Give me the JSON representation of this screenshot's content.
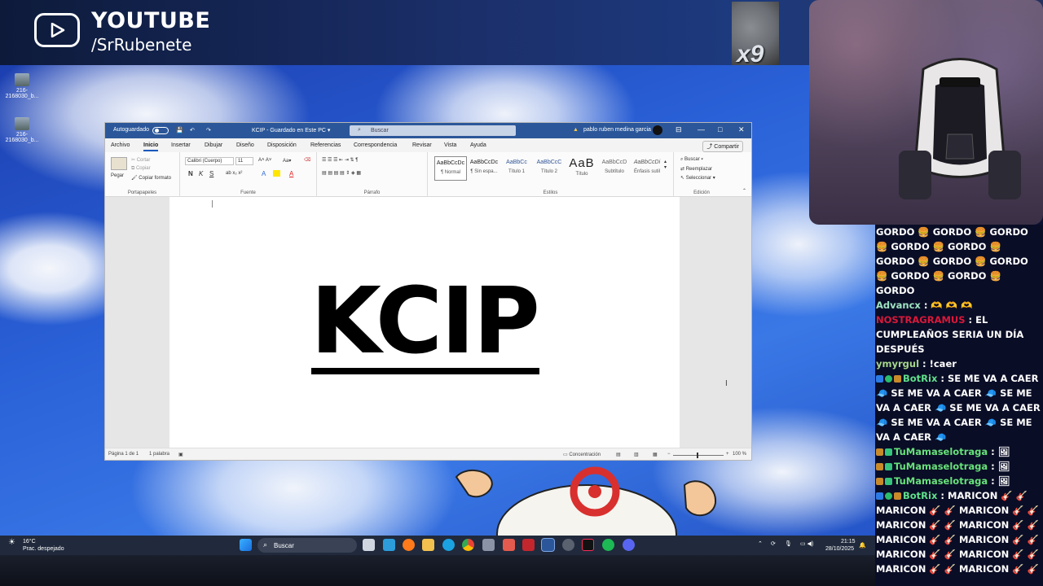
{
  "overlay": {
    "platform": "YOUTUBE",
    "handle": "/SrRubenete",
    "multiplier": "x9"
  },
  "desktop": {
    "icons": [
      {
        "label": "216-2168030_b..."
      },
      {
        "label": "216-2168030_b..."
      }
    ]
  },
  "word": {
    "autosave_label": "Autoguardado",
    "doc_title": "KCIP  -  Guardado en Este PC  ▾",
    "search_placeholder": "Buscar",
    "user_name": "pablo ruben medina garcia",
    "menu_tabs": [
      "Archivo",
      "Inicio",
      "Insertar",
      "Dibujar",
      "Diseño",
      "Disposición",
      "Referencias",
      "Correspondencia",
      "Revisar",
      "Vista",
      "Ayuda"
    ],
    "active_tab": "Inicio",
    "share_label": "Compartir",
    "clipboard": {
      "paste": "Pegar",
      "cut": "Cortar",
      "copy": "Copiar",
      "format_painter": "Copiar formato",
      "group": "Portapapeles"
    },
    "font": {
      "name": "Calibri (Cuerpo)",
      "size": "11",
      "group": "Fuente",
      "bold": "N",
      "italic": "K",
      "underline": "S"
    },
    "paragraph": {
      "group": "Párrafo"
    },
    "styles": [
      {
        "preview": "AaBbCcDc",
        "name": "¶ Normal"
      },
      {
        "preview": "AaBbCcDc",
        "name": "¶ Sin espa..."
      },
      {
        "preview": "AaBbCc",
        "name": "Título 1"
      },
      {
        "preview": "AaBbCcC",
        "name": "Título 2"
      },
      {
        "preview": "AaB",
        "name": "Título"
      },
      {
        "preview": "AaBbCcD",
        "name": "Subtítulo"
      },
      {
        "preview": "AaBbCcDi",
        "name": "Énfasis sutil"
      }
    ],
    "styles_group": "Estilos",
    "editing": {
      "find": "Buscar",
      "replace": "Reemplazar",
      "select": "Seleccionar",
      "group": "Edición"
    },
    "document_text": "KCIP",
    "status": {
      "page": "Página 1 de 1",
      "words": "1 palabra",
      "focus": "Concentración",
      "zoom": "100 %"
    }
  },
  "taskbar": {
    "temperature": "16°C",
    "weather": "Prac. despejado",
    "search_label": "Buscar",
    "time": "21:15",
    "date": "28/10/2025"
  },
  "chat": {
    "messages": [
      {
        "user": "",
        "text": "GORDO 🍔 GORDO 🍔 GORDO 🍔 GORDO 🍔 GORDO 🍔 GORDO 🍔 GORDO 🍔 GORDO 🍔 GORDO 🍔 GORDO 🍔 GORDO"
      },
      {
        "user": "Advancx",
        "text": " : 🫶 🫶 🫶"
      },
      {
        "user": "NOSTRAGRAMUS",
        "text": " : EL CUMPLEAÑOS SERIA UN DÍA DESPUÉS"
      },
      {
        "user": "ymyrgul",
        "text": " : !caer"
      },
      {
        "user": "BotRix",
        "text": " : SE ME VA A CAER 🧢 SE ME VA A CAER 🧢 SE ME VA A CAER 🧢 SE ME VA A CAER 🧢 SE ME VA A CAER 🧢 SE ME VA A CAER 🧢"
      },
      {
        "user": "TuMamaselotraga",
        "text": " : 🖼"
      },
      {
        "user": "TuMamaselotraga",
        "text": " : 🖼"
      },
      {
        "user": "TuMamaselotraga",
        "text": " : 🖼"
      },
      {
        "user": "BotRix",
        "text": " : MARICON 🎸 🎸 MARICON 🎸 🎸 MARICON 🎸 🎸 MARICON 🎸 🎸 MARICON 🎸 🎸 MARICON 🎸 🎸 MARICON 🎸 🎸 MARICON 🎸 🎸 MARICON 🎸 🎸 MARICON 🎸 🎸 MARICON 🎸 🎸"
      }
    ]
  },
  "colors": {
    "word_blue": "#2b579a",
    "chat_bg": "#0a0d26",
    "desktop_sky": "#2a61d8"
  }
}
